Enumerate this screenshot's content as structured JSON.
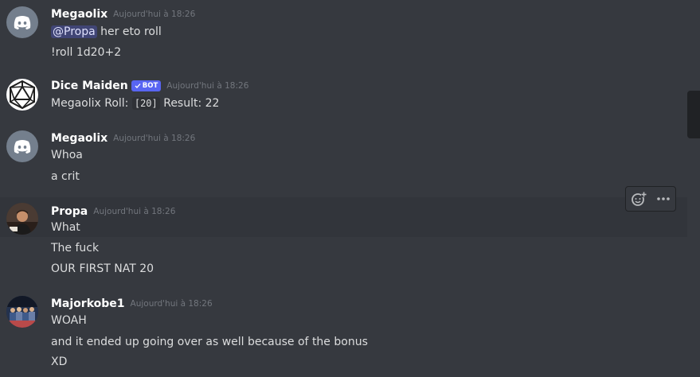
{
  "messages": [
    {
      "author": "Megaolix",
      "timestamp": "Aujourd'hui à 18:26",
      "avatar": "discord-logo-icon",
      "lines": [
        {
          "mention": "@Propa",
          "text": " her eto roll"
        },
        {
          "text": "!roll 1d20+2"
        }
      ]
    },
    {
      "author": "Dice Maiden",
      "bot_tag": "BOT",
      "timestamp": "Aujourd'hui à 18:26",
      "avatar": "d20-dice-icon",
      "lines": [
        {
          "prefix": "Megaolix Roll: ",
          "code": "[20]",
          "suffix": " Result: 22"
        }
      ]
    },
    {
      "author": "Megaolix",
      "timestamp": "Aujourd'hui à 18:26",
      "avatar": "discord-logo-icon",
      "lines": [
        {
          "text": "Whoa"
        },
        {
          "text": "a crit"
        }
      ]
    },
    {
      "author": "Propa",
      "timestamp": "Aujourd'hui à 18:26",
      "avatar": "user-photo",
      "lines": [
        {
          "text": "What"
        },
        {
          "text": "The fuck"
        },
        {
          "text": "OUR FIRST NAT 20"
        }
      ]
    },
    {
      "author": "Majorkobe1",
      "timestamp": "Aujourd'hui à 18:26",
      "avatar": "user-photo",
      "lines": [
        {
          "text": "WOAH"
        },
        {
          "text": "and it ended up going over as well because of the bonus"
        },
        {
          "text": "XD"
        }
      ]
    }
  ],
  "toolbar": {
    "reaction_icon": "add-reaction-icon",
    "more_icon": "more-options-icon"
  },
  "colors": {
    "background": "#36393f",
    "hover_background": "#32353b",
    "discord_blurple": "#5865f2",
    "mention_text": "#dee0fc",
    "timestamp": "#72767d"
  }
}
